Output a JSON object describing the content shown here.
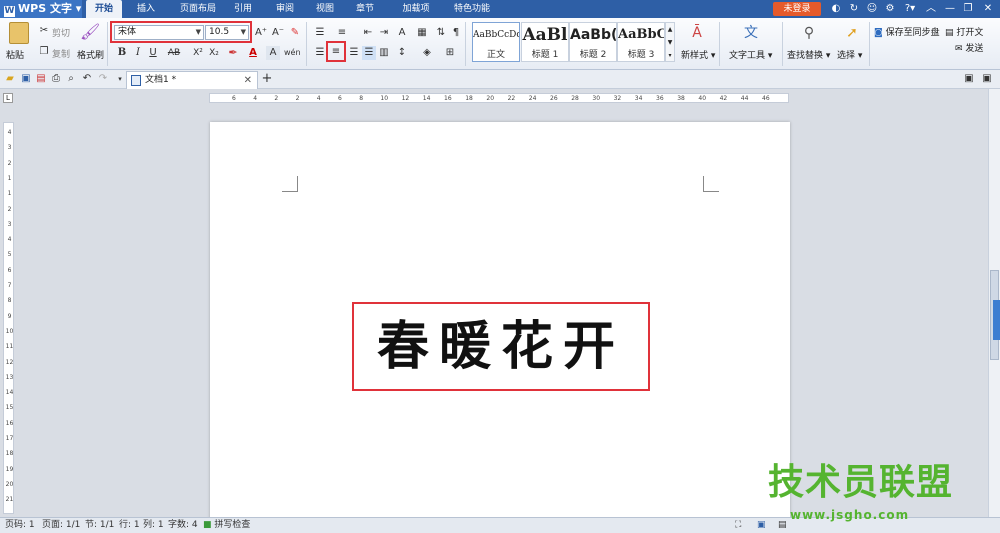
{
  "app": {
    "name": "WPS 文字"
  },
  "menu_tabs": [
    "开始",
    "插入",
    "页面布局",
    "引用",
    "审阅",
    "视图",
    "章节",
    "加载项",
    "特色功能"
  ],
  "login_label": "未登录",
  "clipboard": {
    "paste": "粘贴",
    "cut": "剪切",
    "copy": "复制",
    "format_painter": "格式刷"
  },
  "font": {
    "name": "宋体",
    "size": "10.5"
  },
  "format_buttons": {
    "bold": "B",
    "italic": "I",
    "underline": "U",
    "strike": "AB",
    "superscript": "X²",
    "subscript": "X₂"
  },
  "styles": [
    {
      "sample": "AaBbCcDd",
      "name": "正文"
    },
    {
      "sample": "AaBl",
      "name": "标题 1"
    },
    {
      "sample": "AaBb(",
      "name": "标题 2"
    },
    {
      "sample": "AaBbC",
      "name": "标题 3"
    }
  ],
  "ribbon_actions": {
    "new_style": "新样式",
    "text_tools": "文字工具",
    "find_replace": "查找替换",
    "select": "选择",
    "save_sync": "保存至同步盘",
    "open_doc": "打开文",
    "send": "发送"
  },
  "document_tab": {
    "title": "文档1 *"
  },
  "ruler_numbers": [
    "6",
    "4",
    "2",
    "2",
    "4",
    "6",
    "8",
    "10",
    "12",
    "14",
    "16",
    "18",
    "20",
    "22",
    "24",
    "26",
    "28",
    "30",
    "32",
    "34",
    "36",
    "38",
    "40",
    "42",
    "44",
    "46"
  ],
  "vruler_numbers": [
    "4",
    "3",
    "2",
    "1",
    "1",
    "2",
    "3",
    "4",
    "5",
    "6",
    "7",
    "8",
    "9",
    "10",
    "11",
    "12",
    "13",
    "14",
    "15",
    "16",
    "17",
    "18",
    "19",
    "20",
    "21"
  ],
  "document_text": "春暖花开",
  "status": {
    "page_code": "页码: 1",
    "page": "页面: 1/1",
    "section": "节: 1/1",
    "row": "行: 1",
    "col": "列: 1",
    "word_count": "字数: 4",
    "spell_check": "拼写检查"
  },
  "watermark": {
    "text": "技术员联盟",
    "url": "www.jsgho.com"
  },
  "colors": {
    "menubar": "#2e5fa6",
    "highlight": "#e0323a",
    "login": "#e55a2b",
    "watermark": "#55b430"
  }
}
